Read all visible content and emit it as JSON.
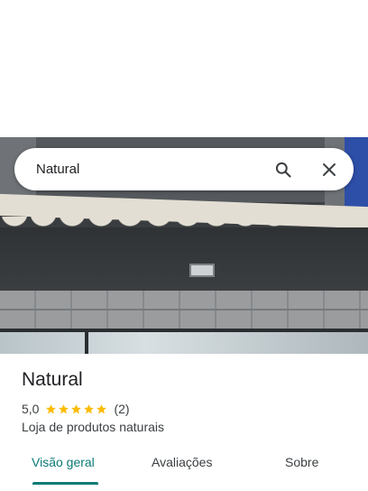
{
  "search": {
    "value": "Natural"
  },
  "place": {
    "name": "Natural",
    "rating": "5,0",
    "stars": 5,
    "review_count": "(2)",
    "category": "Loja de produtos naturais"
  },
  "tabs": [
    {
      "label": "Visão geral",
      "active": true
    },
    {
      "label": "Avaliações",
      "active": false
    },
    {
      "label": "Sobre",
      "active": false
    }
  ],
  "colors": {
    "accent": "#0b7a77",
    "star": "#fbbc04",
    "text": "#202124"
  },
  "icons": {
    "search": "search-icon",
    "close": "close-icon",
    "star": "star-icon"
  }
}
